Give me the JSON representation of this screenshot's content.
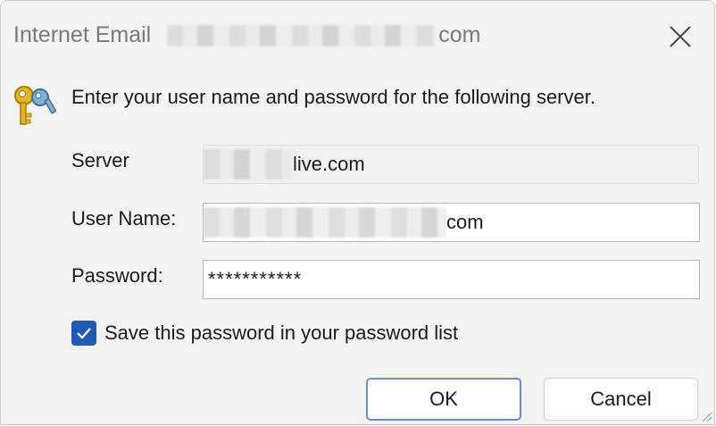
{
  "window": {
    "title_prefix": "Internet Email",
    "title_suffix": "com",
    "close_icon": "close-icon"
  },
  "prompt": {
    "icon": "key-icon",
    "text": "Enter your user name and password for the following server."
  },
  "fields": {
    "server_label": "Server",
    "server_value_suffix": "live.com",
    "username_label": "User Name:",
    "username_value_suffix": "com",
    "password_label": "Password:",
    "password_value": "***********"
  },
  "save_password": {
    "checked": true,
    "label": "Save this password in your password list"
  },
  "buttons": {
    "ok": "OK",
    "cancel": "Cancel"
  },
  "colors": {
    "accent": "#1f5bb5",
    "default_button_border": "#6a8fc9"
  }
}
